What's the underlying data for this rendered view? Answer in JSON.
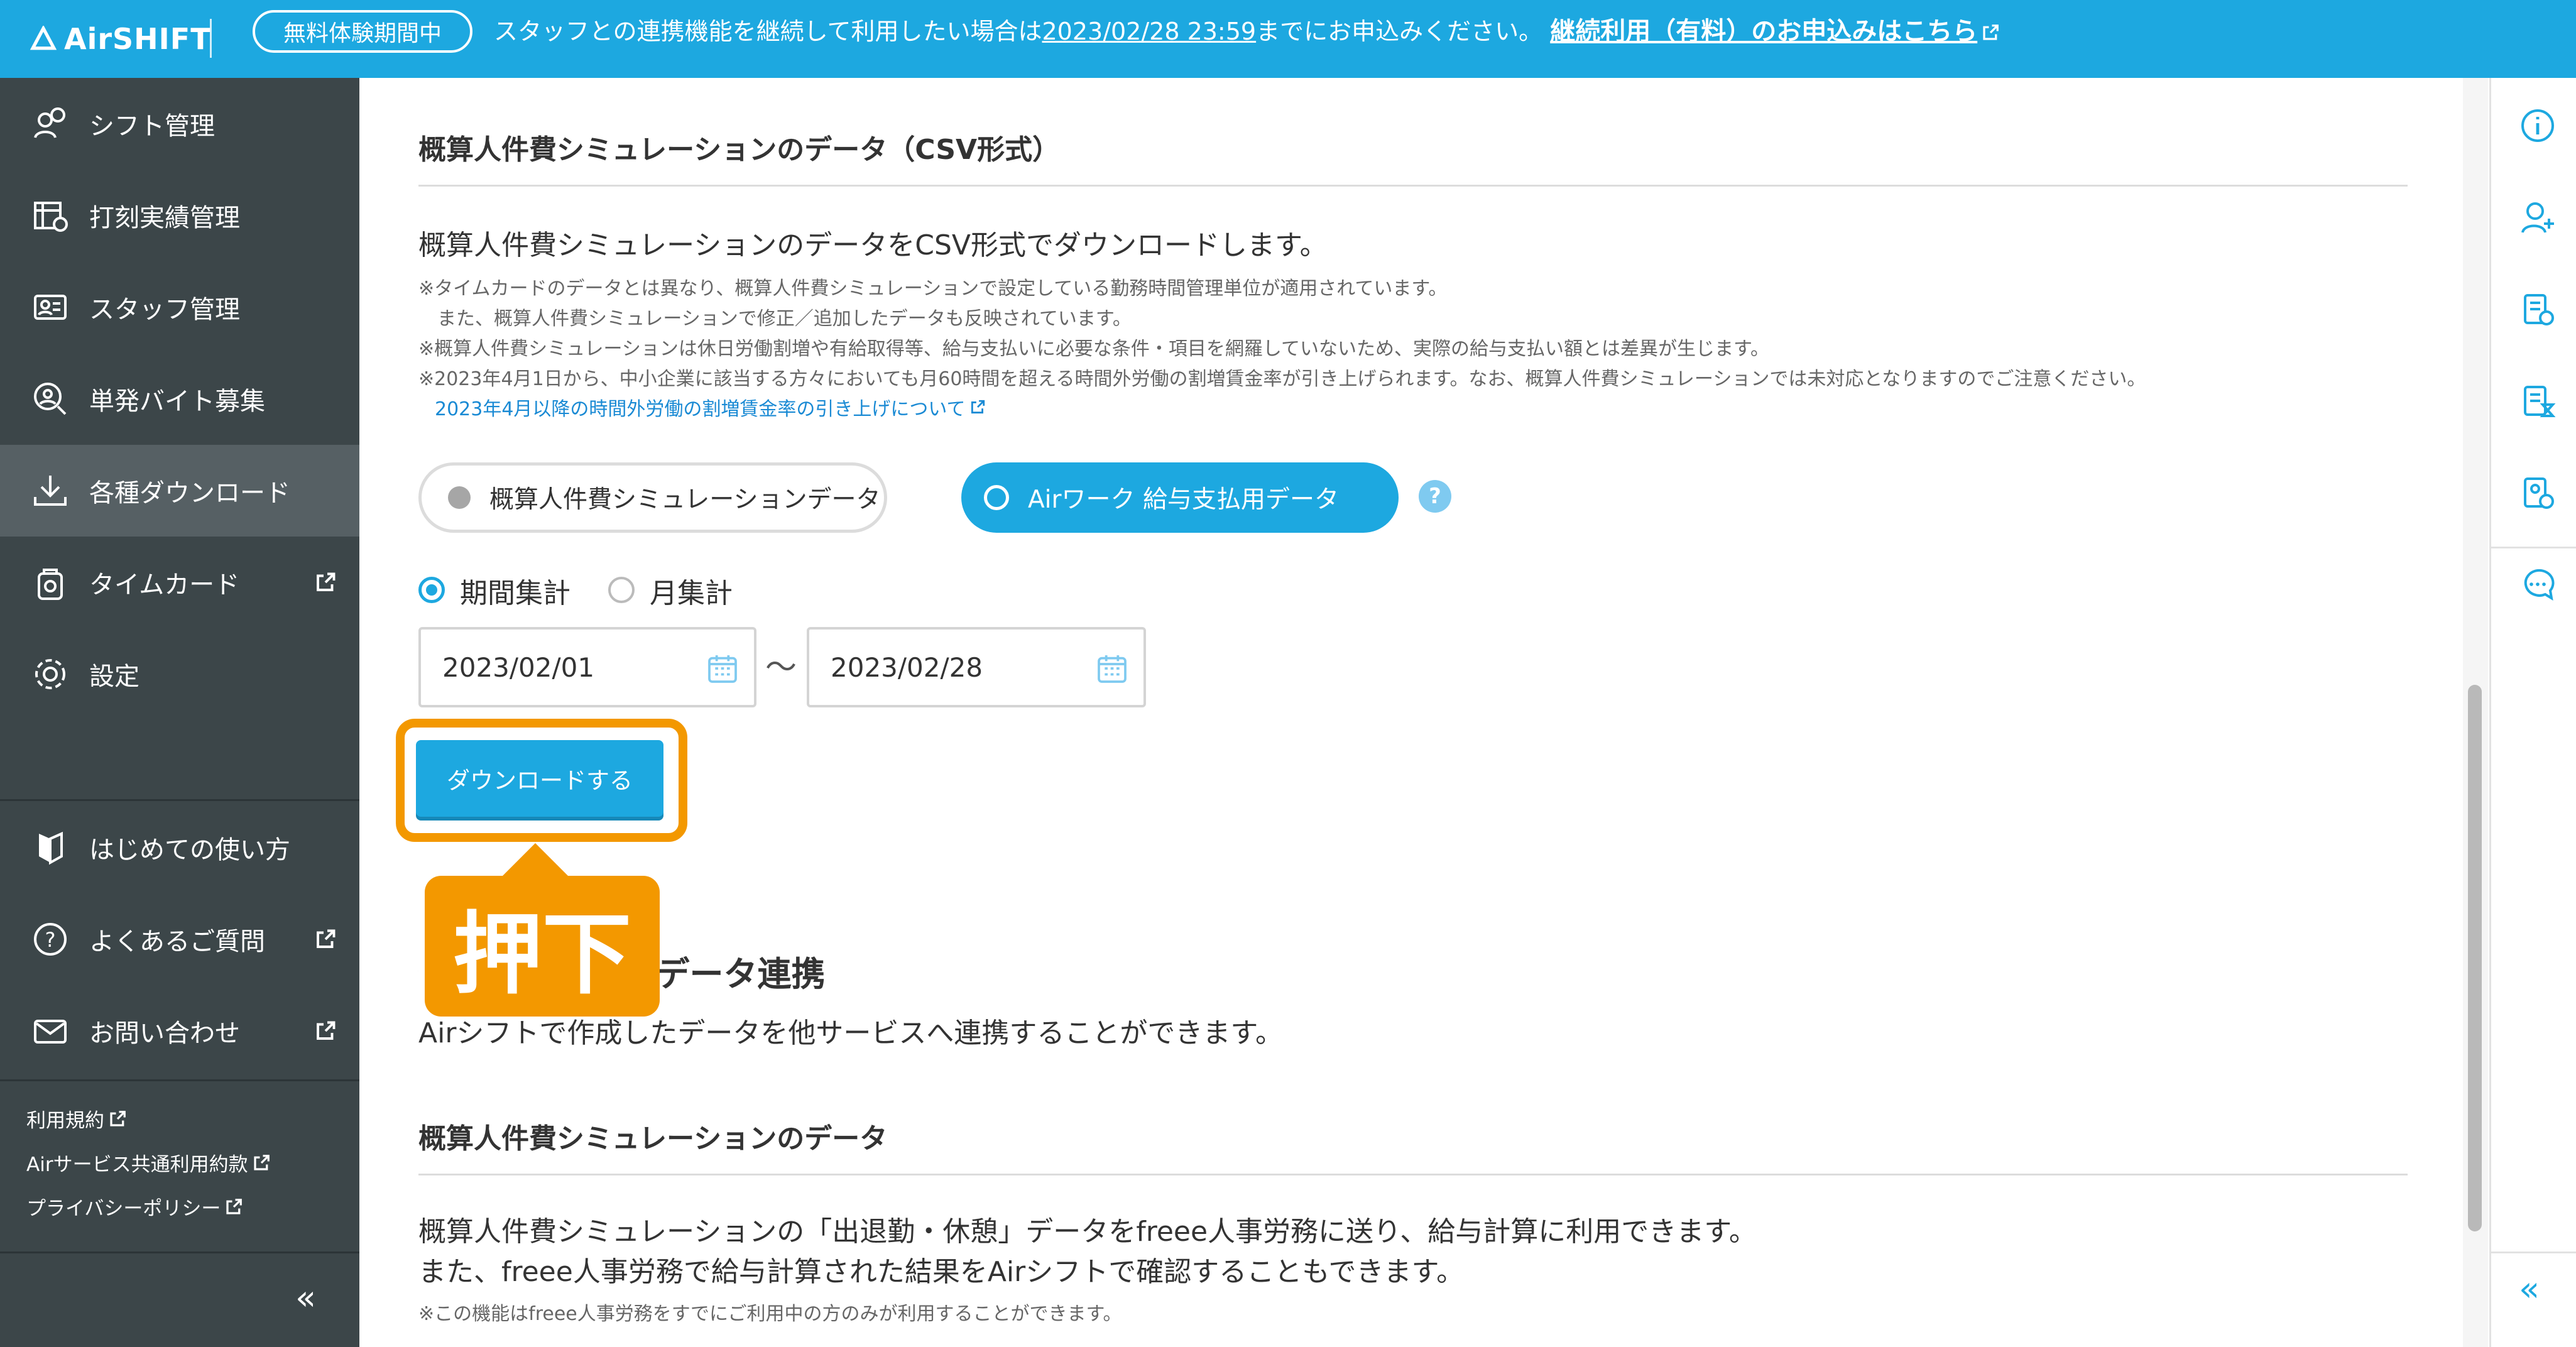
{
  "banner": {
    "logo": "AirSHIFT",
    "trial_badge": "無料体験期間中",
    "message_before": "スタッフとの連携機能を継続して利用したい場合は",
    "deadline": "2023/02/28 23:59",
    "message_after": "までにお申込みください。",
    "link": "継続利用（有料）のお申込みはこちら"
  },
  "sidebar": {
    "items": [
      {
        "label": "シフト管理",
        "icon": "shift-icon"
      },
      {
        "label": "打刻実績管理",
        "icon": "timecard-record-icon"
      },
      {
        "label": "スタッフ管理",
        "icon": "staff-icon"
      },
      {
        "label": "単発バイト募集",
        "icon": "recruit-icon"
      },
      {
        "label": "各種ダウンロード",
        "icon": "download-icon",
        "active": true
      },
      {
        "label": "タイムカード",
        "icon": "timecard-icon",
        "external": true
      },
      {
        "label": "設定",
        "icon": "gear-icon"
      }
    ],
    "help_items": [
      {
        "label": "はじめての使い方",
        "icon": "beginner-icon"
      },
      {
        "label": "よくあるご質問",
        "icon": "question-icon",
        "external": true
      },
      {
        "label": "お問い合わせ",
        "icon": "mail-icon",
        "external": true
      }
    ],
    "footer_links": [
      "利用規約",
      "Airサービス共通利用約款",
      "プライバシーポリシー"
    ],
    "collapse": "«"
  },
  "csv_section": {
    "title": "概算人件費シミュレーションのデータ（CSV形式）",
    "lead": "概算人件費シミュレーションのデータをCSV形式でダウンロードします。",
    "notes": [
      "※タイムカードのデータとは異なり、概算人件費シミュレーションで設定している勤務時間管理単位が適用されています。",
      "　また、概算人件費シミュレーションで修正／追加したデータも反映されています。",
      "※概算人件費シミュレーションは休日労働割増や有給取得等、給与支払いに必要な条件・項目を網羅していないため、実際の給与支払い額とは差異が生じます。",
      "※2023年4月1日から、中小企業に該当する方々においても月60時間を超える時間外労働の割増賃金率が引き上げられます。なお、概算人件費シミュレーションでは未対応となりますのでご注意ください。"
    ],
    "note_link": "2023年4月以降の時間外労働の割増賃金率の引き上げについて",
    "segment_off": "概算人件費シミュレーションデータ",
    "segment_on": "Airワーク 給与支払用データ",
    "help": "?",
    "radio_period": "期間集計",
    "radio_month": "月集計",
    "date_from": "2023/02/01",
    "tilde": "〜",
    "date_to": "2023/02/28",
    "download_button": "ダウンロードする",
    "callout": "押下"
  },
  "link_section": {
    "title": "他サービスとのデータ連携",
    "lead": "Airシフトで作成したデータを他サービスへ連携することができます。",
    "subtitle": "概算人件費シミュレーションのデータ",
    "body1": "概算人件費シミュレーションの「出退勤・休憩」データをfreee人事労務に送り、給与計算に利用できます。",
    "body2": "また、freee人事労務で給与計算された結果をAirシフトで確認することもできます。",
    "note": "※この機能はfreee人事労務をすでにご利用中の方のみが利用することができます。"
  },
  "rail": {
    "icons": [
      "info-icon",
      "add-user-icon",
      "checklist-icon",
      "hourglass-doc-icon",
      "approval-icon",
      "chat-icon"
    ],
    "collapse": "«"
  },
  "colors": {
    "brand": "#1da8e0",
    "sidebar": "#3c4649",
    "sidebar_active": "#566064",
    "highlight": "#f39800"
  }
}
